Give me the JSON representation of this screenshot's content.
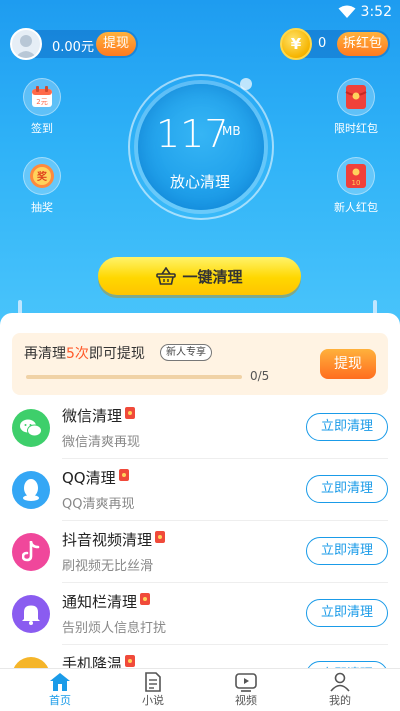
{
  "status_bar": {
    "time": "3:52"
  },
  "header": {
    "balance": "0.00元",
    "withdraw_label": "提现",
    "coins": "0",
    "open_redpack_label": "拆红包",
    "coin_symbol": "¥",
    "sign_in_label": "签到",
    "sign_in_icon_text": "2元",
    "lottery_label": "抽奖",
    "lottery_icon_text": "奖",
    "timed_redpack_label": "限时红包",
    "new_user_redpack_label": "新人红包",
    "new_user_redpack_icon_text": "10",
    "junk_size": "117",
    "junk_unit": "MB",
    "circle_caption": "放心清理",
    "one_click_clean_label": "一键清理"
  },
  "tip": {
    "prefix": "再清理",
    "count": "5次",
    "suffix": "即可提现",
    "badge": "新人专享",
    "progress_text": "0/5",
    "progress_fraction": 0,
    "withdraw_label": "提现"
  },
  "clean_items": [
    {
      "title": "微信清理",
      "subtitle": "微信清爽再现",
      "button": "立即清理",
      "icon": "wechat-icon",
      "color": "#3ecf6b"
    },
    {
      "title": "QQ清理",
      "subtitle": "QQ清爽再现",
      "button": "立即清理",
      "icon": "qq-icon",
      "color": "#35a7f5"
    },
    {
      "title": "抖音视频清理",
      "subtitle": "刷视频无比丝滑",
      "button": "立即清理",
      "icon": "douyin-icon",
      "color": "#f0479b"
    },
    {
      "title": "通知栏清理",
      "subtitle": "告别烦人信息打扰",
      "button": "立即清理",
      "icon": "bell-icon",
      "color": "#8a5cf0"
    },
    {
      "title": "手机降温",
      "subtitle": "",
      "button": "立即清理",
      "icon": "cooling-icon",
      "color": "#f5b52a"
    }
  ],
  "tabs": [
    {
      "label": "首页",
      "icon": "home-icon",
      "active": true
    },
    {
      "label": "小说",
      "icon": "novel-icon",
      "active": false
    },
    {
      "label": "视频",
      "icon": "video-icon",
      "active": false
    },
    {
      "label": "我的",
      "icon": "profile-icon",
      "active": false
    }
  ],
  "colors": {
    "primary": "#1a9be8",
    "accent": "#ff7a1f",
    "button_yellow": "#ffd700"
  }
}
